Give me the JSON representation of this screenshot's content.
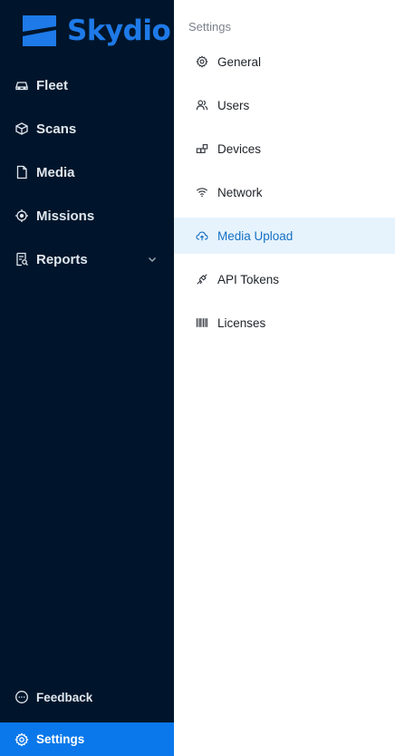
{
  "brand": {
    "name": "Skydio",
    "color": "#1e7ae8"
  },
  "colors": {
    "sidebar_bg": "#00152b",
    "accent": "#0a78ea",
    "active_sub_bg": "#e6f3fc",
    "active_sub_text": "#1570c4"
  },
  "sidebar": {
    "items": [
      {
        "label": "Fleet",
        "icon": "drone-icon"
      },
      {
        "label": "Scans",
        "icon": "cube-icon"
      },
      {
        "label": "Media",
        "icon": "file-icon"
      },
      {
        "label": "Missions",
        "icon": "target-icon"
      },
      {
        "label": "Reports",
        "icon": "report-icon",
        "expandable": true
      }
    ],
    "bottom": {
      "feedback": {
        "label": "Feedback",
        "icon": "chat-bubble-icon"
      },
      "settings": {
        "label": "Settings",
        "icon": "gear-icon",
        "active": true
      }
    }
  },
  "settings_menu": {
    "title": "Settings",
    "items": [
      {
        "label": "General",
        "icon": "gear-icon"
      },
      {
        "label": "Users",
        "icon": "users-icon"
      },
      {
        "label": "Devices",
        "icon": "devices-icon"
      },
      {
        "label": "Network",
        "icon": "wifi-icon"
      },
      {
        "label": "Media Upload",
        "icon": "cloud-upload-icon",
        "active": true
      },
      {
        "label": "API Tokens",
        "icon": "plug-icon"
      },
      {
        "label": "Licenses",
        "icon": "barcode-icon"
      }
    ]
  }
}
